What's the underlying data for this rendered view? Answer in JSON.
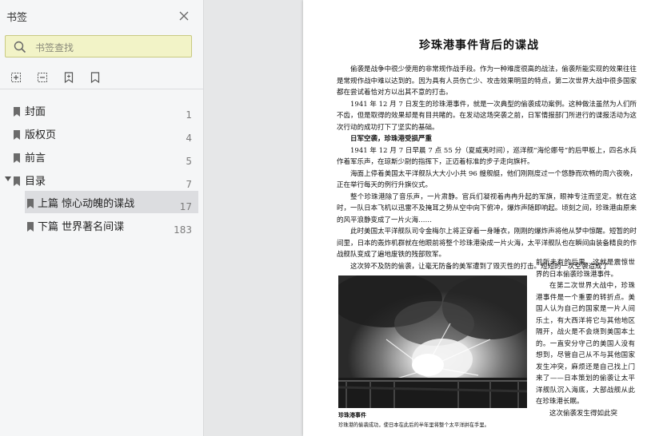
{
  "sidebar": {
    "title": "书签",
    "search_placeholder": "书签查找",
    "items": [
      {
        "label": "封面",
        "page": "1"
      },
      {
        "label": "版权页",
        "page": "4"
      },
      {
        "label": "前言",
        "page": "5"
      },
      {
        "label": "目录",
        "page": "7"
      },
      {
        "label": "上篇  惊心动魄的谍战",
        "page": "17"
      },
      {
        "label": "下篇  世界著名间谍",
        "page": "183"
      }
    ]
  },
  "doc": {
    "title": "珍珠港事件背后的谍战",
    "paras": [
      "偷袭是战争中很少使用的非常规作战手段。作为一种难度很高的战法，偷袭所能实现的效果往往是常规作战中难以达到的。因为具有人员伤亡少、攻击效果明显的特点，第二次世界大战中很多国家都在尝试着恰对方以出其不意的打击。",
      "1941 年 12 月 7 日发生的珍珠港事件，就是一次典型的偷袭成功案例。这种做法虽然为人们所不齿，但是取得的效果却是有目共睹的。在发动这场突袭之前，日军情报部门所进行的谍报活动为这次行动的成功打下了坚实的基础。"
    ],
    "heading": "日军空袭，珍珠港受损严重",
    "paras2": [
      "1941 年 12 月 7 日早晨 7 点 55 分（夏威夷时间），巡洋舰“海伦娜号”的后甲板上，四名水兵作着军乐声，在琼斯少尉的指挥下，正迈着标准的步子走向旗杆。",
      "海面上停着美国太平洋舰队大大小小共 96 艘舰艇，他们刚刚度过一个悠静而欢畅的周六夜晚，正在举行每天的例行升旗仪式。",
      "整个珍珠港除了音乐声，一片肃静。官兵们凝视着冉冉升起的军旗，眼神专注而坚定。就在这时，一队日本飞机以迅雷不及掩耳之势从空中向下俯冲，爆炸声随即响起。顷刻之间，珍珠港由原来的风平浪静变成了一片火海……",
      "此时美国太平洋舰队司令金梅尔上将正穿着一身睡衣，刚刚的爆炸声将他从梦中惊醒。短暂的时间里，日本的轰炸机群就在他眼前将整个珍珠港染成一片火海，太平洋舰队也在瞬间由装备精良的作战舰队变成了遍地废铁的残部败军。",
      "这次猝不及防的偷袭，让毫无防备的美军遭到了毁灭性的打击。短短的一次空袭造成了"
    ],
    "right_col": [
      "前所未有的后果，这就是震惊世界的日本偷袭珍珠港事件。",
      "在第二次世界大战中，珍珠港事件是一个重要的转折点。美国人认为自己的国家是一片人间乐土，有大西洋将它与其他地区隔开，战火是不会烧到美国本土的。一直安分守己的美国人没有想到，尽管自己从不与其他国家发生冲突，麻烦还是自己找上门来了——日本策划的偷袭让太平洋舰队沉入海底，大部战舰从此在珍珠港长眠。",
      "这次偷袭发生得如此突"
    ],
    "caption_title": "珍珠港事件",
    "caption": "珍珠港的偷袭成功，使日本在此后的半年里将整个太平洋拱在手里。"
  }
}
